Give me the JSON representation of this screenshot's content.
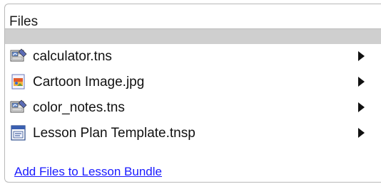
{
  "panel": {
    "title": "Files"
  },
  "files": [
    {
      "name": "calculator.tns",
      "icon": "tns-file-icon"
    },
    {
      "name": "Cartoon Image.jpg",
      "icon": "image-file-icon"
    },
    {
      "name": "color_notes.tns",
      "icon": "tns-file-icon"
    },
    {
      "name": "Lesson Plan Template.tnsp",
      "icon": "tnsp-file-icon"
    }
  ],
  "add_link": "Add Files to Lesson Bundle",
  "colors": {
    "header_bar": "#cfcfcf",
    "link": "#1a1aff"
  }
}
